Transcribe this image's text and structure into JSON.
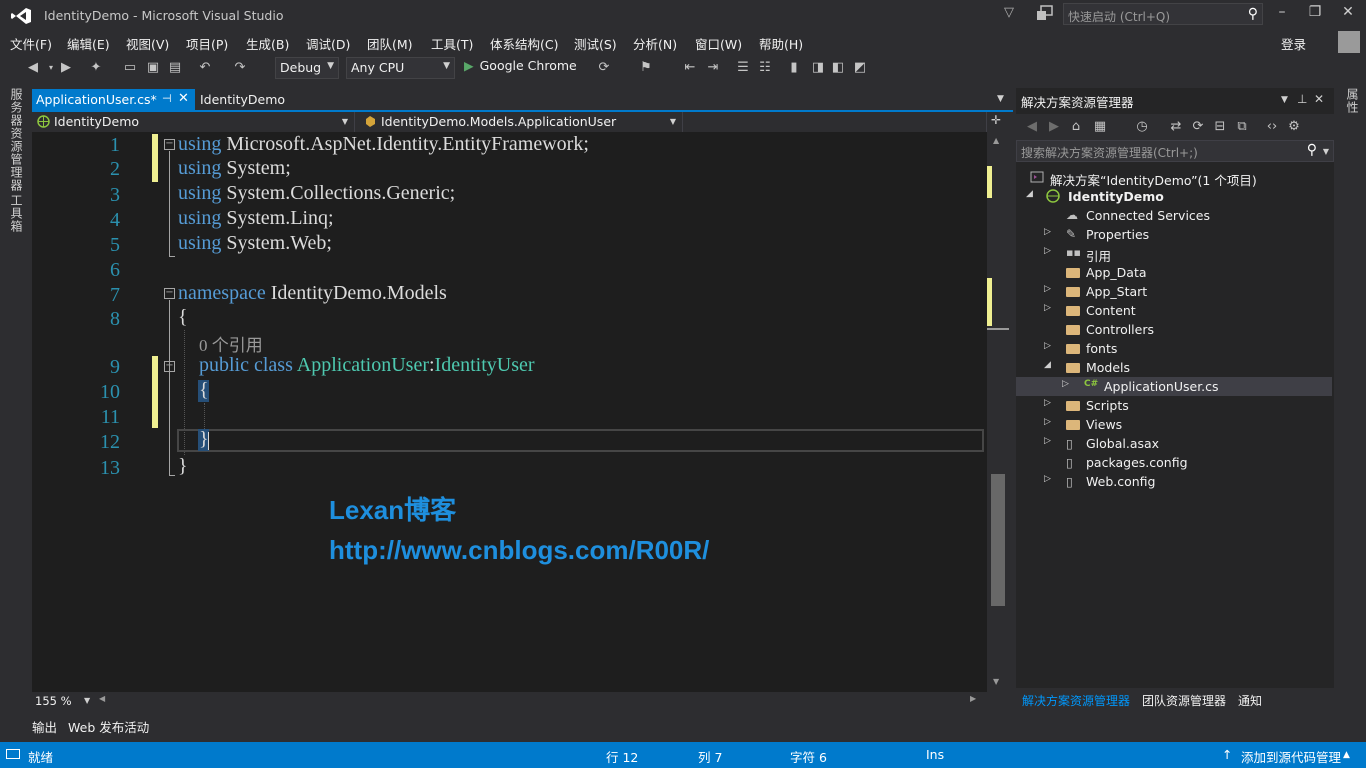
{
  "window": {
    "title": "IdentityDemo - Microsoft Visual Studio",
    "quick_launch_placeholder": "快速启动 (Ctrl+Q)",
    "sign_in": "登录"
  },
  "menu": [
    "文件(F)",
    "编辑(E)",
    "视图(V)",
    "项目(P)",
    "生成(B)",
    "调试(D)",
    "团队(M)",
    "工具(T)",
    "体系结构(C)",
    "测试(S)",
    "分析(N)",
    "窗口(W)",
    "帮助(H)"
  ],
  "toolbar": {
    "config": "Debug",
    "platform": "Any CPU",
    "run_target": "Google Chrome"
  },
  "left_strip": [
    "服务器资源管理器",
    "工具箱"
  ],
  "right_strip": [
    "属性"
  ],
  "tabs": {
    "active": "ApplicationUser.cs*",
    "second": "IdentityDemo"
  },
  "navbar": {
    "project": "IdentityDemo",
    "class": "IdentityDemo.Models.ApplicationUser",
    "member": ""
  },
  "editor": {
    "line_numbers": [
      "1",
      "2",
      "3",
      "4",
      "5",
      "6",
      "7",
      "8",
      "9",
      "10",
      "11",
      "12",
      "13"
    ],
    "lens_text": "0 个引用",
    "code": {
      "l1_kw": "using",
      "l1_rest": " Microsoft.AspNet.Identity.EntityFramework;",
      "l2_kw": "using",
      "l2_rest": " System;",
      "l3_kw": "using",
      "l3_rest": " System.Collections.Generic;",
      "l4_kw": "using",
      "l4_rest": " System.Linq;",
      "l5_kw": "using",
      "l5_rest": " System.Web;",
      "l7_kw": "namespace",
      "l7_rest": " IdentityDemo.Models",
      "l8": "{",
      "l9_kw1": "public",
      "l9_kw2": "class",
      "l9_ty1": "ApplicationUser",
      "l9_colon": ":",
      "l9_ty2": "IdentityUser",
      "l10": "{",
      "l12": "}",
      "l13": "}"
    },
    "watermark_title": "Lexan博客",
    "watermark_url": "http://www.cnblogs.com/R00R/",
    "zoom": "155 %"
  },
  "solution_explorer": {
    "title": "解决方案资源管理器",
    "search_placeholder": "搜索解决方案资源管理器(Ctrl+;)",
    "tree": [
      {
        "label": "解决方案“IdentityDemo”(1 个项目)",
        "icon": "solution-icon"
      },
      {
        "label": "IdentityDemo",
        "icon": "web-project-icon"
      },
      {
        "label": "Connected Services",
        "icon": "cloud-icon"
      },
      {
        "label": "Properties",
        "icon": "wrench-icon"
      },
      {
        "label": "引用",
        "icon": "references-icon"
      },
      {
        "label": "App_Data",
        "icon": "folder-icon"
      },
      {
        "label": "App_Start",
        "icon": "folder-icon"
      },
      {
        "label": "Content",
        "icon": "folder-icon"
      },
      {
        "label": "Controllers",
        "icon": "folder-icon"
      },
      {
        "label": "fonts",
        "icon": "folder-icon"
      },
      {
        "label": "Models",
        "icon": "folder-icon"
      },
      {
        "label": "ApplicationUser.cs",
        "icon": "csharp-file-icon"
      },
      {
        "label": "Scripts",
        "icon": "folder-icon"
      },
      {
        "label": "Views",
        "icon": "folder-icon"
      },
      {
        "label": "Global.asax",
        "icon": "file-icon"
      },
      {
        "label": "packages.config",
        "icon": "config-file-icon"
      },
      {
        "label": "Web.config",
        "icon": "config-file-icon"
      }
    ],
    "bottom_tabs": [
      "解决方案资源管理器",
      "团队资源管理器",
      "通知"
    ]
  },
  "output_tabs": [
    "输出",
    "Web 发布活动"
  ],
  "status": {
    "ready": "就绪",
    "line": "行 12",
    "col": "列 7",
    "char": "字符 6",
    "mode": "Ins",
    "source_control": "添加到源代码管理"
  },
  "colors": {
    "accent": "#007acc",
    "keyword": "#569cd6",
    "type": "#4ec9b0",
    "line_number": "#2b91af",
    "watermark": "#1e8fde"
  }
}
